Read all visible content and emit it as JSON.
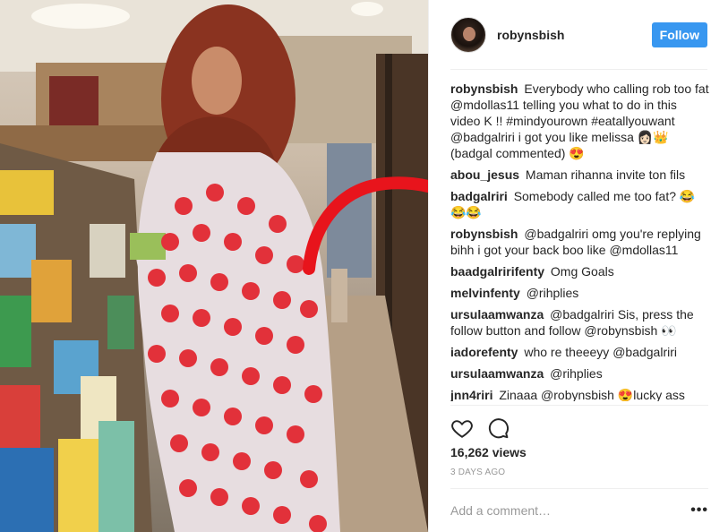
{
  "post": {
    "author": "robynsbish",
    "follow_label": "Follow",
    "views": "16,262 views",
    "age": "3 DAYS AGO",
    "comment_placeholder": "Add a comment…",
    "more_label": "•••"
  },
  "comments": [
    {
      "user": "robynsbish",
      "text": "Everybody who calling rob too fat @mdollas11 telling you what to do in this video K !! #mindyourown #eatallyouwant @badgalriri i got you like melissa 👩🏻👑 (badgal commented) 😍"
    },
    {
      "user": "abou_jesus",
      "text": "Maman rihanna invite ton fils"
    },
    {
      "user": "badgalriri",
      "text": "Somebody called me too fat? 😂😂😂"
    },
    {
      "user": "robynsbish",
      "text": "@badgalriri omg you're replying bihh i got your back boo like @mdollas11"
    },
    {
      "user": "baadgalririfenty",
      "text": "Omg Goals"
    },
    {
      "user": "melvinfenty",
      "text": "@rihplies"
    },
    {
      "user": "ursulaamwanza",
      "text": "@badgalriri Sis, press the follow button and follow @robynsbish 👀"
    },
    {
      "user": "iadorefenty",
      "text": "who re theeeyy @badgalriri"
    },
    {
      "user": "ursulaamwanza",
      "text": "@rihplies"
    },
    {
      "user": "jnn4riri",
      "text": "Zinaaa @robynsbish 😍lucky ass"
    }
  ],
  "icons": {
    "like": "heart-icon",
    "comment": "comment-bubble-icon",
    "avatar": "profile-avatar"
  },
  "colors": {
    "follow_button": "#3897f0",
    "annotation_arrow": "#e8141c",
    "dress_dots": "#e2313a"
  }
}
